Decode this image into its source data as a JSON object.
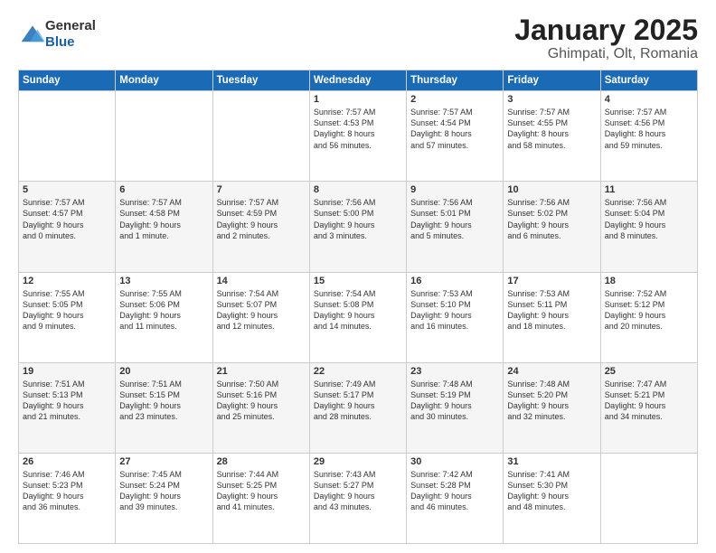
{
  "header": {
    "logo": {
      "general": "General",
      "blue": "Blue"
    },
    "title": "January 2025",
    "location": "Ghimpati, Olt, Romania"
  },
  "days_of_week": [
    "Sunday",
    "Monday",
    "Tuesday",
    "Wednesday",
    "Thursday",
    "Friday",
    "Saturday"
  ],
  "weeks": [
    [
      {
        "day": "",
        "info": ""
      },
      {
        "day": "",
        "info": ""
      },
      {
        "day": "",
        "info": ""
      },
      {
        "day": "1",
        "info": "Sunrise: 7:57 AM\nSunset: 4:53 PM\nDaylight: 8 hours\nand 56 minutes."
      },
      {
        "day": "2",
        "info": "Sunrise: 7:57 AM\nSunset: 4:54 PM\nDaylight: 8 hours\nand 57 minutes."
      },
      {
        "day": "3",
        "info": "Sunrise: 7:57 AM\nSunset: 4:55 PM\nDaylight: 8 hours\nand 58 minutes."
      },
      {
        "day": "4",
        "info": "Sunrise: 7:57 AM\nSunset: 4:56 PM\nDaylight: 8 hours\nand 59 minutes."
      }
    ],
    [
      {
        "day": "5",
        "info": "Sunrise: 7:57 AM\nSunset: 4:57 PM\nDaylight: 9 hours\nand 0 minutes."
      },
      {
        "day": "6",
        "info": "Sunrise: 7:57 AM\nSunset: 4:58 PM\nDaylight: 9 hours\nand 1 minute."
      },
      {
        "day": "7",
        "info": "Sunrise: 7:57 AM\nSunset: 4:59 PM\nDaylight: 9 hours\nand 2 minutes."
      },
      {
        "day": "8",
        "info": "Sunrise: 7:56 AM\nSunset: 5:00 PM\nDaylight: 9 hours\nand 3 minutes."
      },
      {
        "day": "9",
        "info": "Sunrise: 7:56 AM\nSunset: 5:01 PM\nDaylight: 9 hours\nand 5 minutes."
      },
      {
        "day": "10",
        "info": "Sunrise: 7:56 AM\nSunset: 5:02 PM\nDaylight: 9 hours\nand 6 minutes."
      },
      {
        "day": "11",
        "info": "Sunrise: 7:56 AM\nSunset: 5:04 PM\nDaylight: 9 hours\nand 8 minutes."
      }
    ],
    [
      {
        "day": "12",
        "info": "Sunrise: 7:55 AM\nSunset: 5:05 PM\nDaylight: 9 hours\nand 9 minutes."
      },
      {
        "day": "13",
        "info": "Sunrise: 7:55 AM\nSunset: 5:06 PM\nDaylight: 9 hours\nand 11 minutes."
      },
      {
        "day": "14",
        "info": "Sunrise: 7:54 AM\nSunset: 5:07 PM\nDaylight: 9 hours\nand 12 minutes."
      },
      {
        "day": "15",
        "info": "Sunrise: 7:54 AM\nSunset: 5:08 PM\nDaylight: 9 hours\nand 14 minutes."
      },
      {
        "day": "16",
        "info": "Sunrise: 7:53 AM\nSunset: 5:10 PM\nDaylight: 9 hours\nand 16 minutes."
      },
      {
        "day": "17",
        "info": "Sunrise: 7:53 AM\nSunset: 5:11 PM\nDaylight: 9 hours\nand 18 minutes."
      },
      {
        "day": "18",
        "info": "Sunrise: 7:52 AM\nSunset: 5:12 PM\nDaylight: 9 hours\nand 20 minutes."
      }
    ],
    [
      {
        "day": "19",
        "info": "Sunrise: 7:51 AM\nSunset: 5:13 PM\nDaylight: 9 hours\nand 21 minutes."
      },
      {
        "day": "20",
        "info": "Sunrise: 7:51 AM\nSunset: 5:15 PM\nDaylight: 9 hours\nand 23 minutes."
      },
      {
        "day": "21",
        "info": "Sunrise: 7:50 AM\nSunset: 5:16 PM\nDaylight: 9 hours\nand 25 minutes."
      },
      {
        "day": "22",
        "info": "Sunrise: 7:49 AM\nSunset: 5:17 PM\nDaylight: 9 hours\nand 28 minutes."
      },
      {
        "day": "23",
        "info": "Sunrise: 7:48 AM\nSunset: 5:19 PM\nDaylight: 9 hours\nand 30 minutes."
      },
      {
        "day": "24",
        "info": "Sunrise: 7:48 AM\nSunset: 5:20 PM\nDaylight: 9 hours\nand 32 minutes."
      },
      {
        "day": "25",
        "info": "Sunrise: 7:47 AM\nSunset: 5:21 PM\nDaylight: 9 hours\nand 34 minutes."
      }
    ],
    [
      {
        "day": "26",
        "info": "Sunrise: 7:46 AM\nSunset: 5:23 PM\nDaylight: 9 hours\nand 36 minutes."
      },
      {
        "day": "27",
        "info": "Sunrise: 7:45 AM\nSunset: 5:24 PM\nDaylight: 9 hours\nand 39 minutes."
      },
      {
        "day": "28",
        "info": "Sunrise: 7:44 AM\nSunset: 5:25 PM\nDaylight: 9 hours\nand 41 minutes."
      },
      {
        "day": "29",
        "info": "Sunrise: 7:43 AM\nSunset: 5:27 PM\nDaylight: 9 hours\nand 43 minutes."
      },
      {
        "day": "30",
        "info": "Sunrise: 7:42 AM\nSunset: 5:28 PM\nDaylight: 9 hours\nand 46 minutes."
      },
      {
        "day": "31",
        "info": "Sunrise: 7:41 AM\nSunset: 5:30 PM\nDaylight: 9 hours\nand 48 minutes."
      },
      {
        "day": "",
        "info": ""
      }
    ]
  ]
}
